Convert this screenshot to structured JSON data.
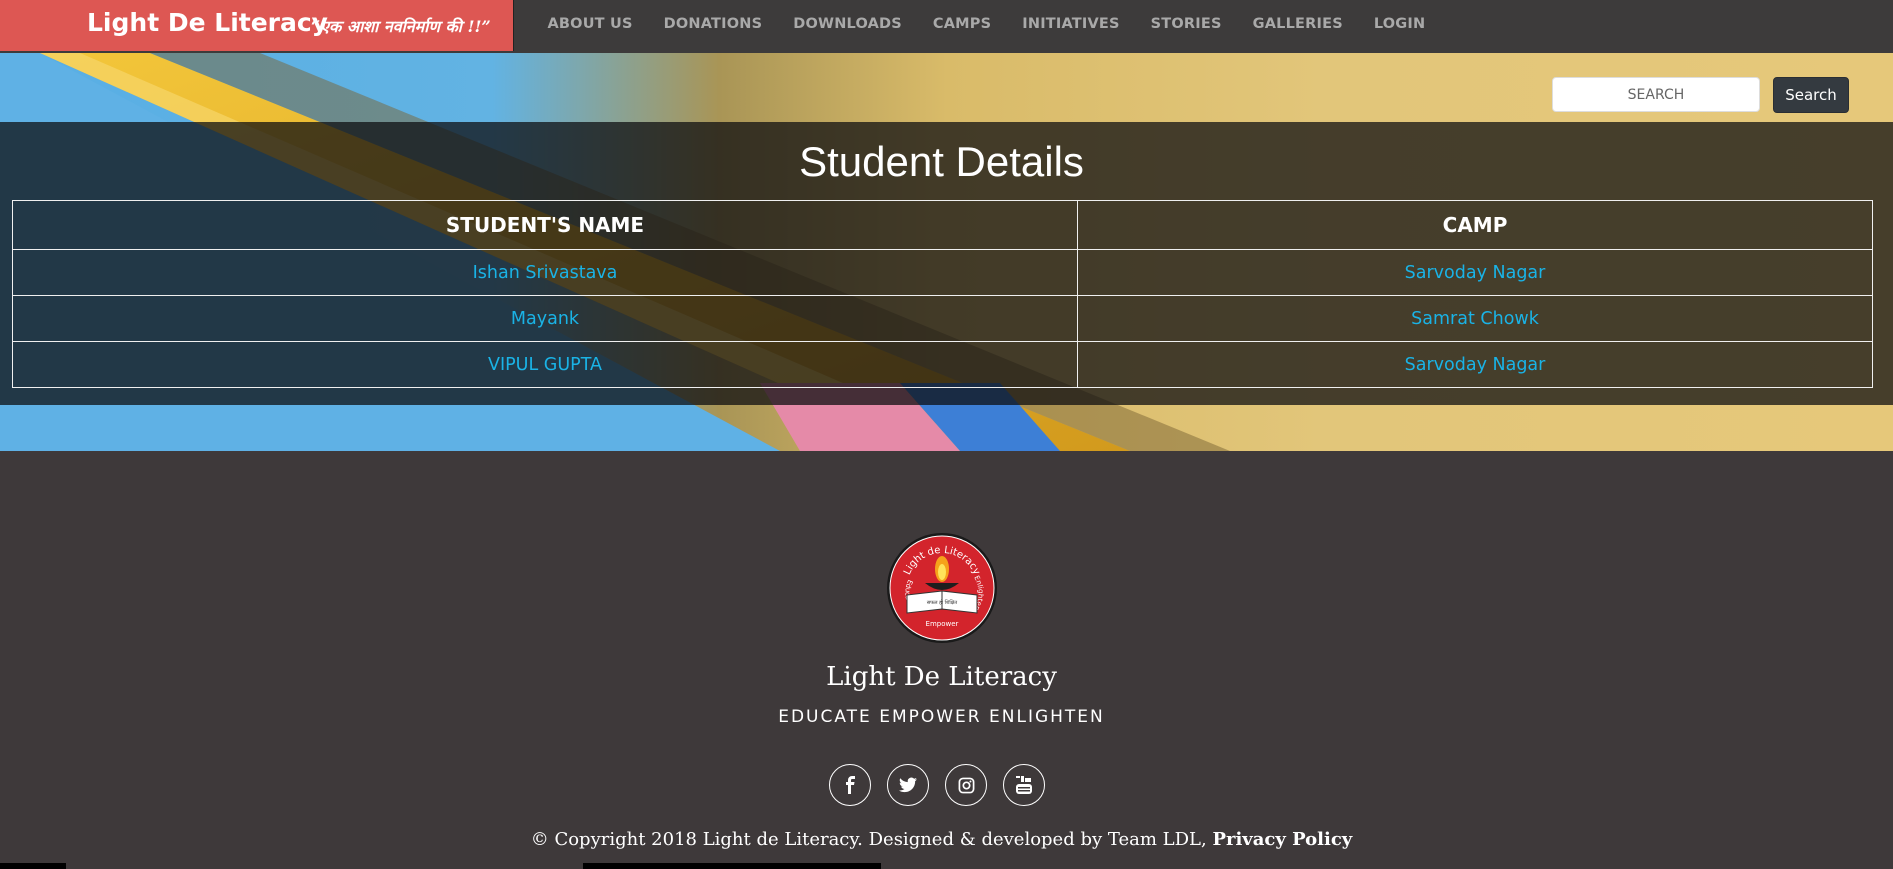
{
  "brand": {
    "name": "Light De Literacy",
    "tagline": "“एक आशा नवनिर्माण की !!”"
  },
  "nav": {
    "items": [
      {
        "label": "ABOUT US"
      },
      {
        "label": "DONATIONS"
      },
      {
        "label": "DOWNLOADS"
      },
      {
        "label": "CAMPS"
      },
      {
        "label": "INITIATIVES"
      },
      {
        "label": "STORIES"
      },
      {
        "label": "GALLERIES"
      },
      {
        "label": "LOGIN"
      }
    ]
  },
  "search": {
    "placeholder": "SEARCH",
    "button_label": "Search"
  },
  "main": {
    "title": "Student Details",
    "table": {
      "headers": {
        "name": "STUDENT'S NAME",
        "camp": "CAMP"
      },
      "rows": [
        {
          "name": "Ishan Srivastava",
          "camp": "Sarvoday Nagar"
        },
        {
          "name": "Mayank",
          "camp": "Samrat Chowk"
        },
        {
          "name": "VIPUL GUPTA",
          "camp": "Sarvoday Nagar"
        }
      ]
    }
  },
  "footer": {
    "logo_texts": {
      "top": "Light de Literacy",
      "left": "Educate",
      "right": "Enlighten",
      "bottom": "Empower",
      "book": "सफल हो शिक्षित"
    },
    "title": "Light De Literacy",
    "motto": "EDUCATE EMPOWER ENLIGHTEN",
    "socials": [
      "facebook-icon",
      "twitter-icon",
      "instagram-icon",
      "youtube-icon"
    ],
    "copyright_text": "© Copyright 2018 Light de Literacy. Designed & developed by Team LDL, ",
    "privacy_label": "Privacy Policy"
  },
  "colors": {
    "brand_red": "#dd5753",
    "navbar_bg": "#3d3b3b",
    "footer_bg": "#3e393a",
    "link_blue": "#1ab3e6"
  }
}
